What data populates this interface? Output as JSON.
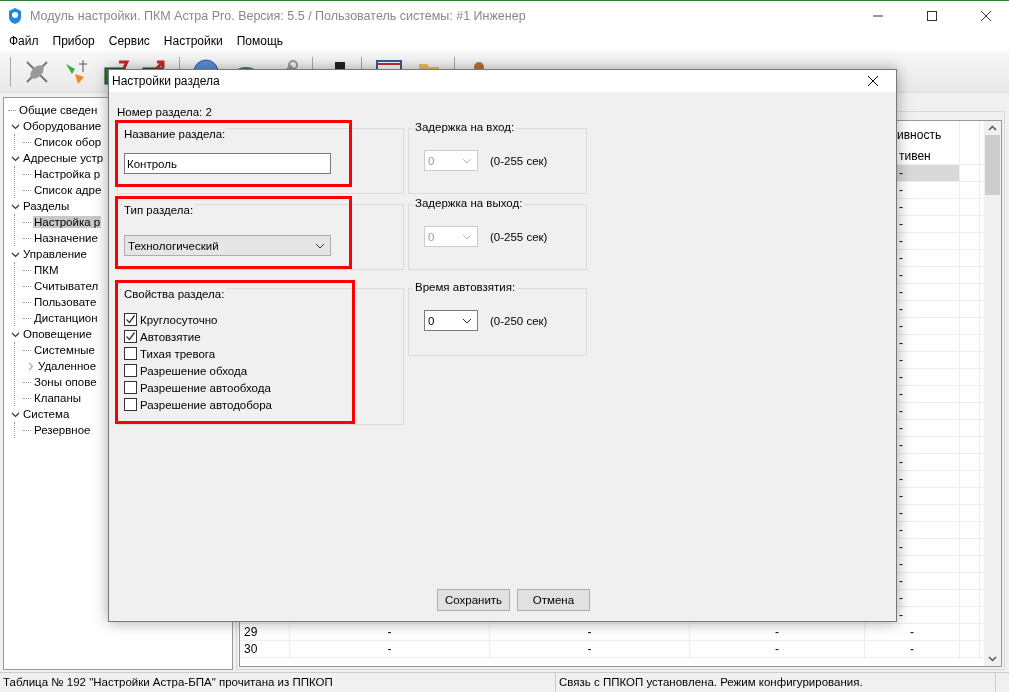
{
  "window": {
    "title": "Модуль настройки. ПКМ Астра Pro. Версия: 5.5 / Пользователь системы: #1 Инженер"
  },
  "menu": [
    "Файл",
    "Прибор",
    "Сервис",
    "Настройки",
    "Помощь"
  ],
  "tree": [
    {
      "label": "Общие сведен",
      "kind": "leaf",
      "selected": false
    },
    {
      "label": "Оборудование",
      "kind": "group",
      "expanded": true,
      "selected": false,
      "children": [
        {
          "label": "Список обор",
          "kind": "leaf",
          "selected": false
        }
      ]
    },
    {
      "label": "Адресные устр",
      "kind": "group",
      "expanded": true,
      "selected": false,
      "children": [
        {
          "label": "Настройка р",
          "kind": "leaf",
          "selected": false
        },
        {
          "label": "Список адре",
          "kind": "leaf",
          "selected": false
        }
      ]
    },
    {
      "label": "Разделы",
      "kind": "group",
      "expanded": true,
      "selected": false,
      "children": [
        {
          "label": "Настройка р",
          "kind": "leaf",
          "selected": true
        },
        {
          "label": "Назначение",
          "kind": "leaf",
          "selected": false
        }
      ]
    },
    {
      "label": "Управление",
      "kind": "group",
      "expanded": true,
      "selected": false,
      "children": [
        {
          "label": "ПКМ",
          "kind": "leaf",
          "selected": false
        },
        {
          "label": "Считывател",
          "kind": "leaf",
          "selected": false
        },
        {
          "label": "Пользовате",
          "kind": "leaf",
          "selected": false
        },
        {
          "label": "Дистанцион",
          "kind": "leaf",
          "selected": false
        }
      ]
    },
    {
      "label": "Оповещение",
      "kind": "group",
      "expanded": true,
      "selected": false,
      "children": [
        {
          "label": "Системные",
          "kind": "leaf",
          "selected": false
        },
        {
          "label": "Удаленное",
          "kind": "group",
          "expanded": false,
          "selected": false
        },
        {
          "label": "Зоны опове",
          "kind": "leaf",
          "selected": false
        },
        {
          "label": "Клапаны",
          "kind": "leaf",
          "selected": false
        }
      ]
    },
    {
      "label": "Система",
      "kind": "group",
      "expanded": true,
      "selected": false,
      "children": [
        {
          "label": "Резервное",
          "kind": "leaf",
          "selected": false
        }
      ]
    }
  ],
  "table": {
    "header": "ивность",
    "partial_rows": [
      {
        "status": "тивен",
        "selected": false
      },
      {
        "status": "-",
        "selected": true
      },
      {
        "status": "-",
        "selected": false
      },
      {
        "status": "-",
        "selected": false
      },
      {
        "status": "-",
        "selected": false
      },
      {
        "status": "-",
        "selected": false
      },
      {
        "status": "-",
        "selected": false
      },
      {
        "status": "-",
        "selected": false
      },
      {
        "status": "-",
        "selected": false
      },
      {
        "status": "-",
        "selected": false
      },
      {
        "status": "-",
        "selected": false
      },
      {
        "status": "-",
        "selected": false
      },
      {
        "status": "-",
        "selected": false
      },
      {
        "status": "-",
        "selected": false
      },
      {
        "status": "-",
        "selected": false
      },
      {
        "status": "-",
        "selected": false
      },
      {
        "status": "-",
        "selected": false
      },
      {
        "status": "-",
        "selected": false
      },
      {
        "status": "-",
        "selected": false
      },
      {
        "status": "-",
        "selected": false
      },
      {
        "status": "-",
        "selected": false
      },
      {
        "status": "-",
        "selected": false
      },
      {
        "status": "-",
        "selected": false
      },
      {
        "status": "-",
        "selected": false
      },
      {
        "status": "-",
        "selected": false
      },
      {
        "status": "-",
        "selected": false
      },
      {
        "status": "-",
        "selected": false
      },
      {
        "status": "-",
        "selected": false
      }
    ],
    "full_rows": [
      {
        "number": "29",
        "cells": [
          "-",
          "-",
          "-",
          "-"
        ]
      },
      {
        "number": "30",
        "cells": [
          "-",
          "-",
          "-",
          "-"
        ]
      }
    ]
  },
  "dialog": {
    "title": "Настройки раздела",
    "number_label": "Номер раздела: 2",
    "groups": [
      {
        "kind": "text",
        "label": "Название раздела:",
        "value": "Контроль",
        "highlighted": true
      },
      {
        "kind": "select",
        "label": "Тип раздела:",
        "value": "Технологический",
        "highlighted": true
      },
      {
        "kind": "checks",
        "label": "Свойства раздела:",
        "highlighted": true,
        "options": [
          {
            "label": "Круглосуточно",
            "checked": true
          },
          {
            "label": "Автовзятие",
            "checked": true
          },
          {
            "label": "Тихая тревога",
            "checked": false
          },
          {
            "label": "Разрешение обхода",
            "checked": false
          },
          {
            "label": "Разрешение автообхода",
            "checked": false
          },
          {
            "label": "Разрешение автодобора",
            "checked": false
          }
        ]
      }
    ],
    "delays": [
      {
        "label": "Задержка на вход:",
        "value": "0",
        "range": "(0-255 сек)",
        "disabled": true
      },
      {
        "label": "Задержка на выход:",
        "value": "0",
        "range": "(0-255 сек)",
        "disabled": true
      },
      {
        "label": "Время автовзятия:",
        "value": "0",
        "range": "(0-250 сек)",
        "disabled": false
      }
    ],
    "buttons": [
      "Сохранить",
      "Отмена"
    ]
  },
  "status_bar": [
    "Таблица № 192 \"Настройки Астра-БПА\" прочитана из ППКОП",
    "Связь с ППКОП установлена. Режим конфигурирования."
  ]
}
